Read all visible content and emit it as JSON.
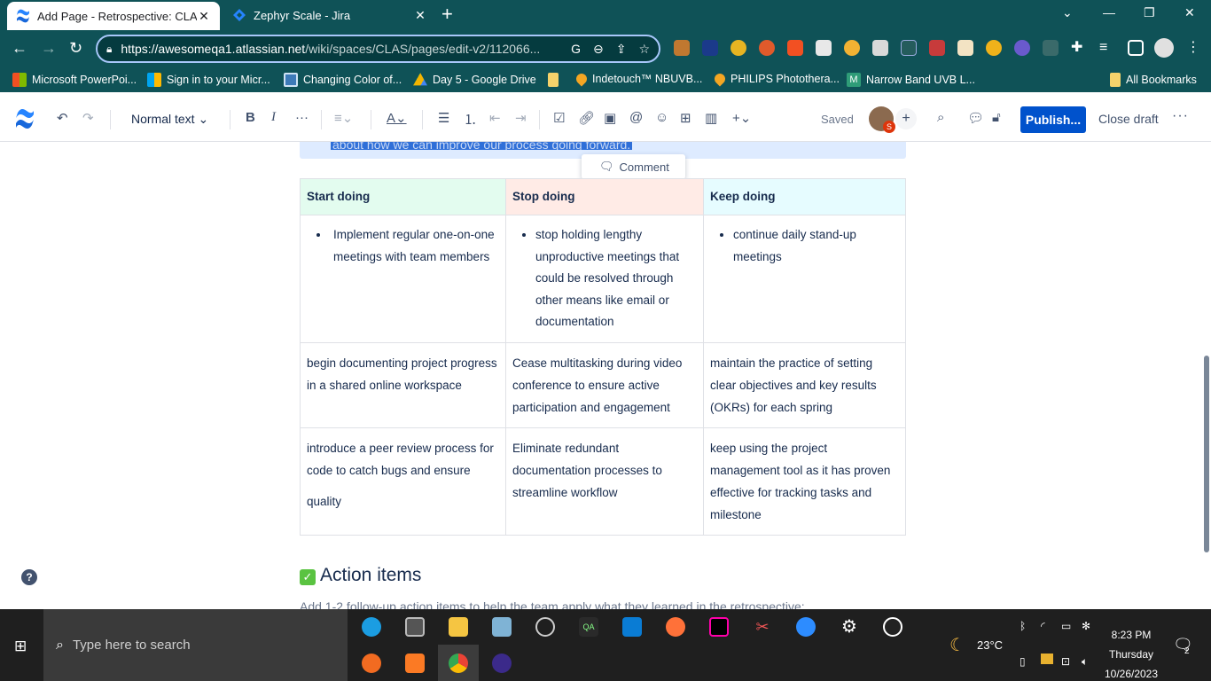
{
  "browser": {
    "tabs": [
      {
        "title": "Add Page - Retrospective: CLAS",
        "active": true
      },
      {
        "title": "Zephyr Scale - Jira",
        "active": false
      }
    ],
    "url_host": "https://awesomeqa1.atlassian.net",
    "url_path": "/wiki/spaces/CLAS/pages/edit-v2/112066...",
    "bookmarks": [
      "Microsoft PowerPoi...",
      "Sign in to your Micr...",
      "Changing Color of...",
      "Day 5 - Google Drive",
      "Indetouch™ NBUVB...",
      "PHILIPS Photothera...",
      "Narrow Band UVB L...",
      "All Bookmarks"
    ],
    "colors": {
      "chrome": "#0f5257",
      "accent": "#0052cc"
    }
  },
  "toolbar": {
    "text_style": "Normal text",
    "saved_label": "Saved",
    "avatar_badge": "S",
    "publish_label": "Publish...",
    "close_draft_label": "Close draft"
  },
  "content": {
    "selected_text": "about how we can improve our process going forward.",
    "comment_label": "Comment",
    "table": {
      "headers": [
        "Start doing",
        "Stop doing",
        "Keep doing"
      ],
      "rows": [
        [
          "Implement regular one-on-one meetings with team members",
          "stop holding lengthy unproductive meetings that could be resolved through other means like email or documentation",
          "continue daily stand-up meetings"
        ],
        [
          "begin documenting project progress in a shared online workspace",
          "Cease multitasking during video conference to ensure active participation and engagement",
          "maintain the practice of setting clear objectives and key results (OKRs) for each spring"
        ],
        [
          "introduce a peer review process for code to catch bugs and ensure",
          "Eliminate redundant documentation  processes to streamline workflow",
          "keep using the project management tool as it has proven effective for tracking tasks and milestone"
        ],
        [
          "quality"
        ]
      ]
    },
    "action_items_heading": "Action items",
    "action_items_sub": "Add 1-2 follow-up action items to help the team apply what they learned in the retrospective:"
  },
  "taskbar": {
    "search_placeholder": "Type here to search",
    "weather": "23°C",
    "time": "8:23 PM",
    "day": "Thursday",
    "date": "10/26/2023",
    "notification_count": "2"
  }
}
